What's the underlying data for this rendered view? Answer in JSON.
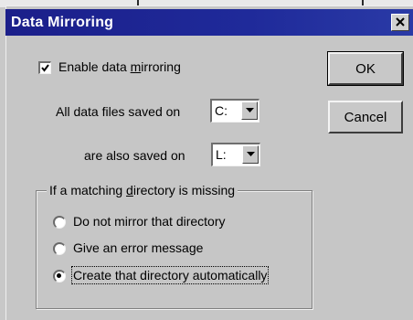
{
  "window": {
    "title": "Data Mirroring",
    "title_bar_color": "#1b1f8a"
  },
  "enable_mirroring": {
    "label_prefix": "Enable data ",
    "label_accel": "m",
    "label_suffix": "irroring",
    "checked": true
  },
  "saved_on": {
    "label": "All data files saved on",
    "value": "C:"
  },
  "also_saved_on": {
    "label": "are also saved on",
    "value": "L:"
  },
  "buttons": {
    "ok": "OK",
    "cancel": "Cancel"
  },
  "missing_directory": {
    "legend_prefix": "If a matching ",
    "legend_accel": "d",
    "legend_suffix": "irectory is missing",
    "options": [
      {
        "label": "Do not mirror that directory",
        "selected": false
      },
      {
        "label": "Give an error message",
        "selected": false
      },
      {
        "label": "Create that directory automatically",
        "selected": true
      }
    ]
  },
  "icons": {
    "close": "close-icon",
    "check": "checkmark-icon",
    "dropdown": "chevron-down-icon"
  }
}
